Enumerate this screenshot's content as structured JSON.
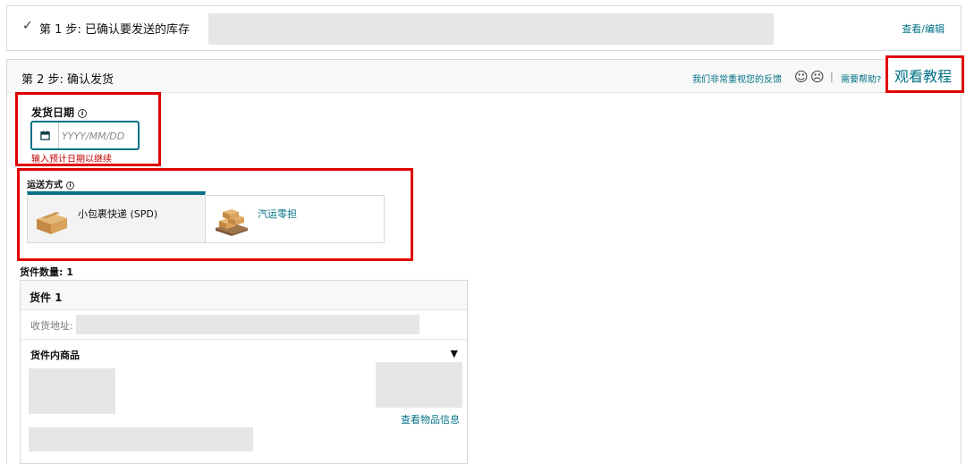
{
  "step1": {
    "check_glyph": "✓",
    "title": "第 1 步:  已确认要发送的库存",
    "edit_link": "查看/编辑"
  },
  "step2": {
    "title": "第 2 步:  确认发货",
    "feedback_link": "我们非常重视您的反馈",
    "smile_glyph": "☺",
    "frown_glyph": "☹",
    "separator": "|",
    "help_link": "需要帮助?",
    "tutorial_link": "观看教程"
  },
  "ship_date": {
    "label": "发货日期",
    "info_glyph": "i",
    "placeholder": "YYYY/MM/DD",
    "value": "",
    "error": "输入预计日期以继续"
  },
  "shipping_method": {
    "label": "运送方式",
    "info_glyph": "i",
    "options": [
      {
        "label": "小包裹快递 (SPD)",
        "icon": "box-icon",
        "selected": true
      },
      {
        "label": "汽运零担",
        "icon": "pallet-icon",
        "selected": false
      }
    ]
  },
  "package_count": "货件数量:  1",
  "package": {
    "title": "货件 1",
    "address_label": "收货地址:",
    "items_title": "货件内商品",
    "toggle_glyph": "▼",
    "view_item_link": "查看物品信息"
  },
  "colors": {
    "accent": "#007185",
    "error": "#c40000",
    "highlight": "#e00000",
    "redacted": "#e6e6e6"
  }
}
